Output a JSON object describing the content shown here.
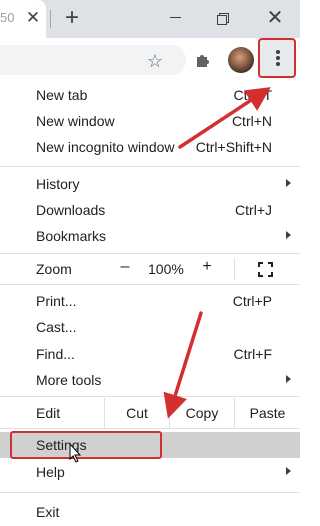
{
  "browser": {
    "tab_title": "50",
    "close_tab_glyph": "✕",
    "new_tab_glyph": "+",
    "window_close_glyph": "✕",
    "star_glyph": "☆",
    "icons": [
      "close-icon",
      "plus-icon",
      "minimize-icon",
      "restore-icon",
      "star-icon",
      "puzzle-icon",
      "avatar",
      "three-dots-icon"
    ]
  },
  "menu": {
    "group1": [
      {
        "label": "New tab",
        "shortcut": "Ctrl+T"
      },
      {
        "label": "New window",
        "shortcut": "Ctrl+N"
      },
      {
        "label": "New incognito window",
        "shortcut": "Ctrl+Shift+N"
      }
    ],
    "group2": [
      {
        "label": "History",
        "shortcut": ""
      },
      {
        "label": "Downloads",
        "shortcut": "Ctrl+J"
      },
      {
        "label": "Bookmarks",
        "shortcut": ""
      }
    ],
    "zoom": {
      "label": "Zoom",
      "minus": "–",
      "value": "100%",
      "plus": "+"
    },
    "group3": [
      {
        "label": "Print...",
        "shortcut": "Ctrl+P"
      },
      {
        "label": "Cast...",
        "shortcut": ""
      },
      {
        "label": "Find...",
        "shortcut": "Ctrl+F"
      },
      {
        "label": "More tools",
        "shortcut": ""
      }
    ],
    "edit": {
      "label": "Edit",
      "cut": "Cut",
      "copy": "Copy",
      "paste": "Paste"
    },
    "settings": {
      "label": "Settings"
    },
    "help": {
      "label": "Help"
    },
    "exit": {
      "label": "Exit"
    }
  },
  "colors": {
    "annotation_red": "#d32f2f",
    "highlight_gray": "#d0d0d0",
    "titlebar_gray": "#dee1e6"
  }
}
